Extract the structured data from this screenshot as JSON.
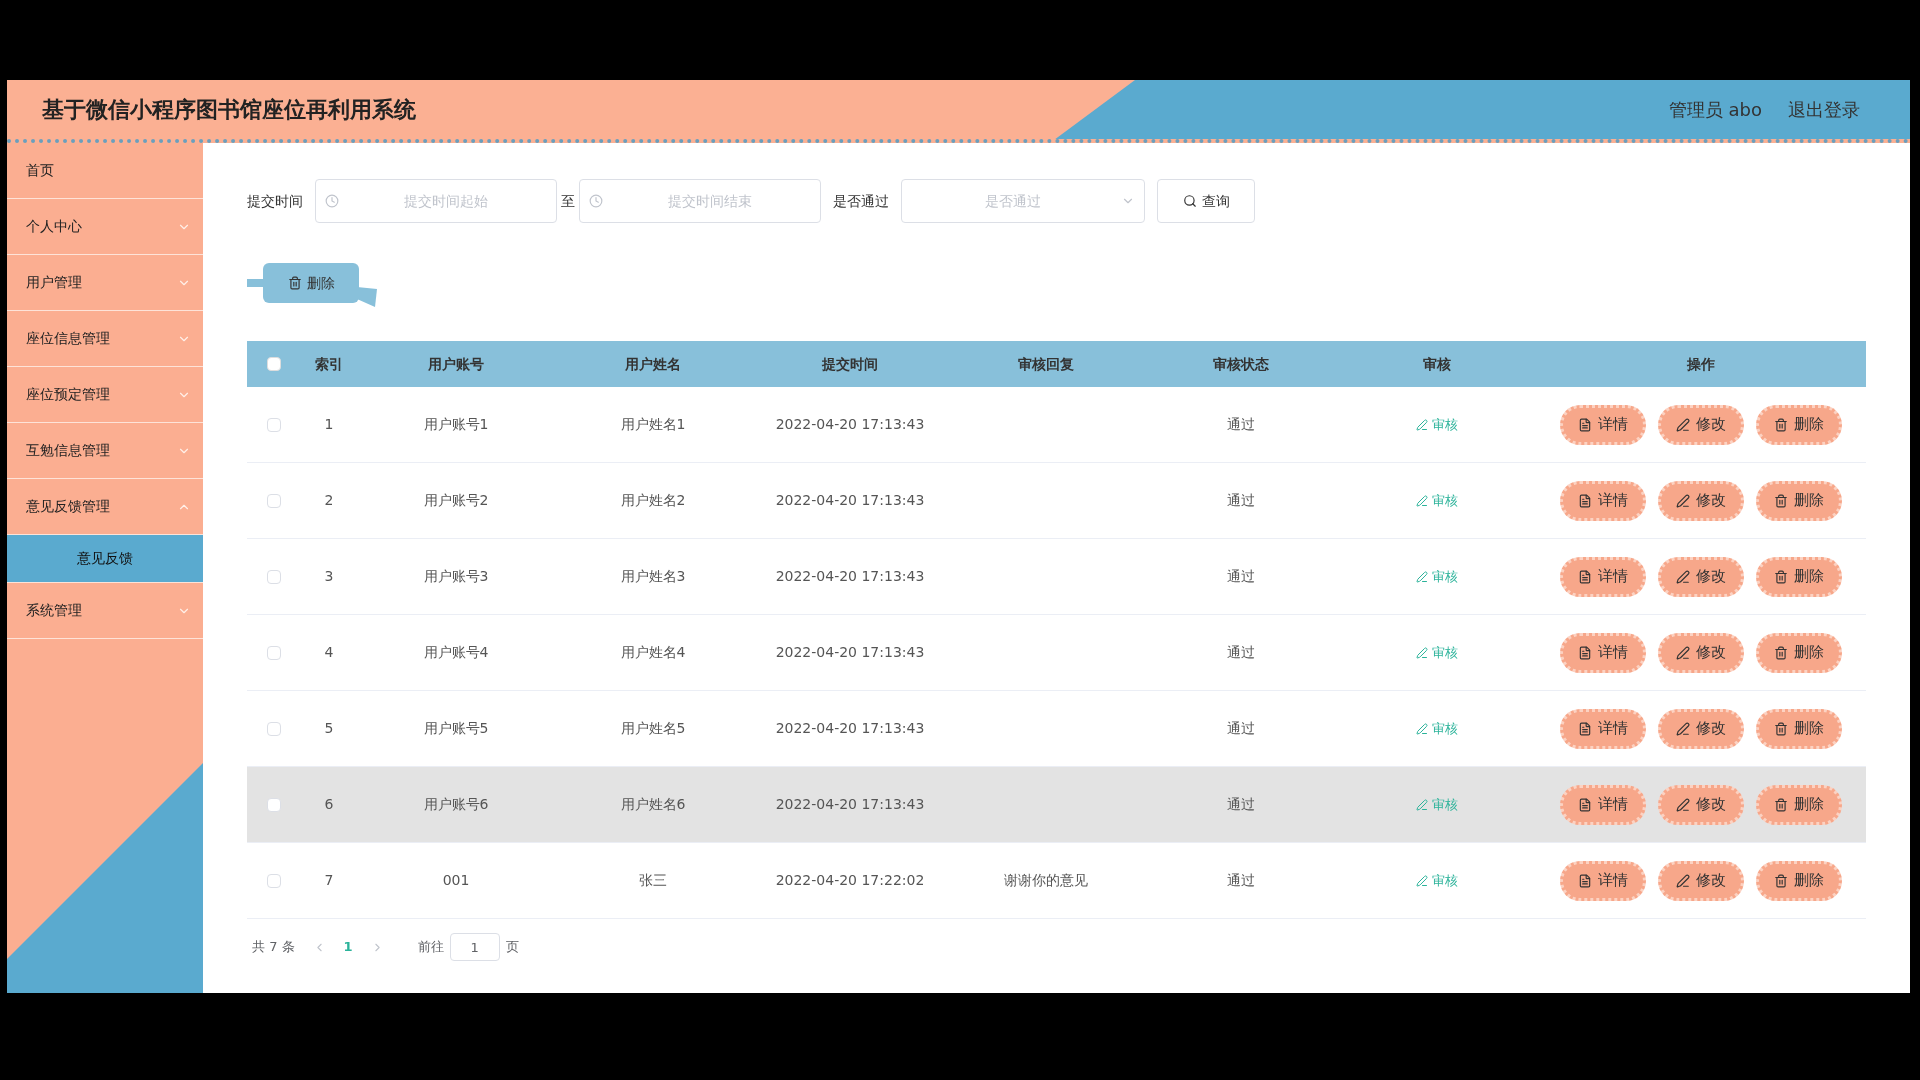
{
  "header": {
    "title": "基于微信小程序图书馆座位再利用系统",
    "user": "管理员 abo",
    "logout": "退出登录"
  },
  "sidebar": {
    "items": [
      {
        "kind": "link",
        "label": "首页"
      },
      {
        "kind": "submenu",
        "label": "个人中心",
        "expanded": false
      },
      {
        "kind": "submenu",
        "label": "用户管理",
        "expanded": false
      },
      {
        "kind": "submenu",
        "label": "座位信息管理",
        "expanded": false
      },
      {
        "kind": "submenu",
        "label": "座位预定管理",
        "expanded": false
      },
      {
        "kind": "submenu",
        "label": "互勉信息管理",
        "expanded": false
      },
      {
        "kind": "submenu",
        "label": "意见反馈管理",
        "expanded": true,
        "children": [
          {
            "label": "意见反馈",
            "selected": true
          }
        ]
      },
      {
        "kind": "submenu",
        "label": "系统管理",
        "expanded": false
      }
    ]
  },
  "filters": {
    "time_label": "提交时间",
    "start_placeholder": "提交时间起始",
    "to": "至",
    "end_placeholder": "提交时间结束",
    "pass_label": "是否通过",
    "pass_placeholder": "是否通过",
    "query": "查询"
  },
  "bulk_delete": "删除",
  "table": {
    "all_checked": false,
    "columns": [
      "索引",
      "用户账号",
      "用户姓名",
      "提交时间",
      "审核回复",
      "审核状态",
      "审核",
      "操作"
    ],
    "rows": [
      {
        "index": "1",
        "account": "用户账号1",
        "name": "用户姓名1",
        "time": "2022-04-20 17:13:43",
        "status": "通过",
        "review": "审核",
        "actions": [
          "详情",
          "修改",
          "删除"
        ],
        "checked": false,
        "highlighted": false
      },
      {
        "index": "2",
        "account": "用户账号2",
        "name": "用户姓名2",
        "time": "2022-04-20 17:13:43",
        "status": "通过",
        "review": "审核",
        "actions": [
          "详情",
          "修改",
          "删除"
        ],
        "checked": false,
        "highlighted": false
      },
      {
        "index": "3",
        "account": "用户账号3",
        "name": "用户姓名3",
        "time": "2022-04-20 17:13:43",
        "status": "通过",
        "review": "审核",
        "actions": [
          "详情",
          "修改",
          "删除"
        ],
        "checked": false,
        "highlighted": false
      },
      {
        "index": "4",
        "account": "用户账号4",
        "name": "用户姓名4",
        "time": "2022-04-20 17:13:43",
        "status": "通过",
        "review": "审核",
        "actions": [
          "详情",
          "修改",
          "删除"
        ],
        "checked": false,
        "highlighted": false
      },
      {
        "index": "5",
        "account": "用户账号5",
        "name": "用户姓名5",
        "time": "2022-04-20 17:13:43",
        "status": "通过",
        "review": "审核",
        "actions": [
          "详情",
          "修改",
          "删除"
        ],
        "checked": false,
        "highlighted": false
      },
      {
        "index": "6",
        "account": "用户账号6",
        "name": "用户姓名6",
        "time": "2022-04-20 17:13:43",
        "status": "通过",
        "review": "审核",
        "actions": [
          "详情",
          "修改",
          "删除"
        ],
        "checked": false,
        "highlighted": true
      },
      {
        "index": "7",
        "account": "001",
        "name": "张三",
        "time": "2022-04-20 17:22:02",
        "reply": "谢谢你的意见",
        "status": "通过",
        "review": "审核",
        "actions": [
          "详情",
          "修改",
          "删除"
        ],
        "checked": false,
        "highlighted": false
      }
    ]
  },
  "pagination": {
    "total": "共 7 条",
    "pages": [
      {
        "label": "1",
        "selected": true
      }
    ],
    "goto": "前往",
    "page_value": "1",
    "page_suffix": "页"
  }
}
